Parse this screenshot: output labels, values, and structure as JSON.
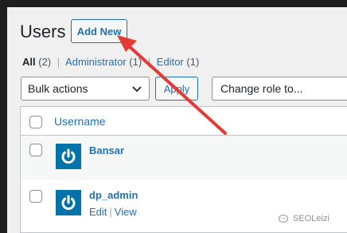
{
  "page": {
    "title": "Users"
  },
  "header": {
    "add_new_label": "Add New"
  },
  "filters": [
    {
      "label": "All",
      "count": "(2)",
      "current": true
    },
    {
      "label": "Administrator",
      "count": "(1)",
      "current": false
    },
    {
      "label": "Editor",
      "count": "(1)",
      "current": false
    }
  ],
  "filter_separator": "|",
  "bulk_actions": {
    "selected": "Bulk actions",
    "apply_label": "Apply"
  },
  "change_role": {
    "selected": "Change role to..."
  },
  "table": {
    "column_username": "Username",
    "rows": [
      {
        "username": "Bansar",
        "actions": []
      },
      {
        "username": "dp_admin",
        "actions": [
          "Edit",
          "View"
        ]
      }
    ]
  },
  "watermark": {
    "text": "SEOLeizi"
  },
  "annotation": {
    "arrow_color": "#e53935"
  },
  "colors": {
    "link": "#2271b1",
    "avatar_bg": "#0073aa"
  }
}
